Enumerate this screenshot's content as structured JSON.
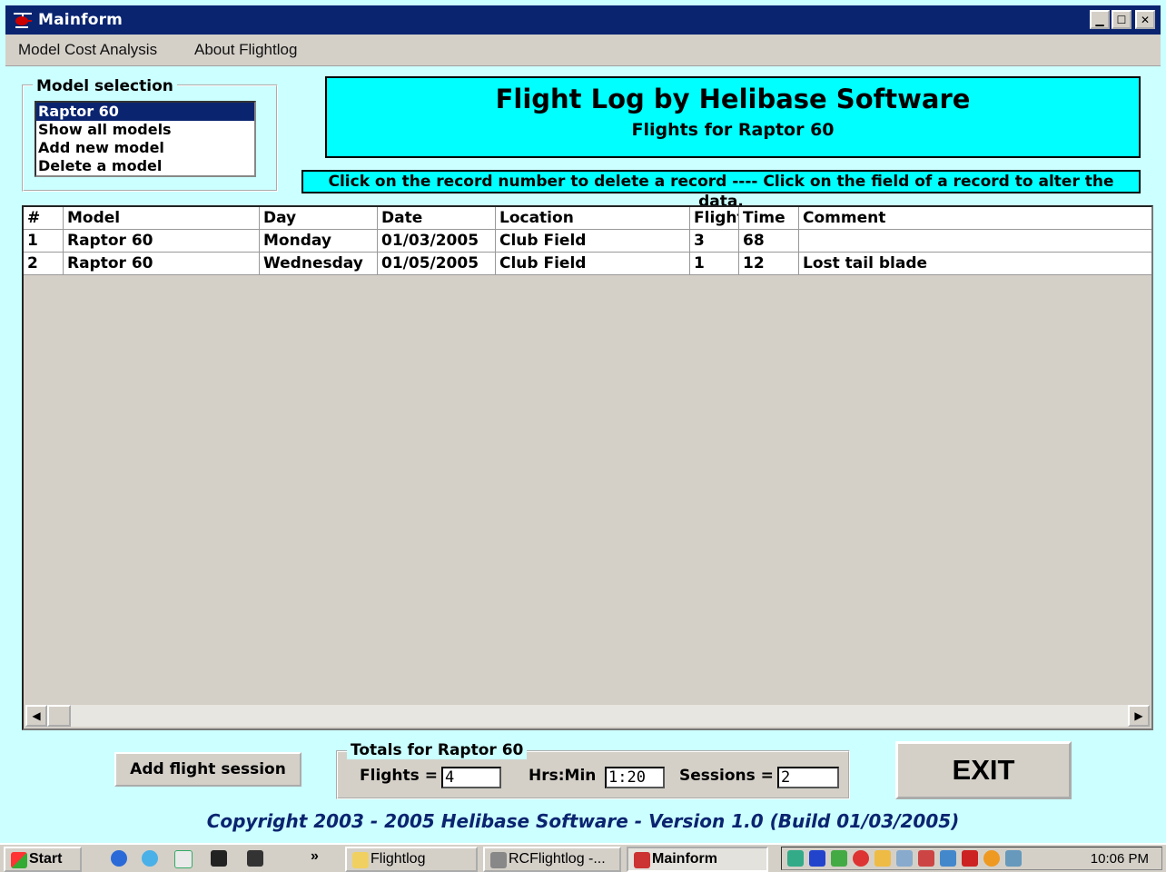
{
  "window": {
    "title": "Mainform"
  },
  "menu": {
    "items": [
      "Model Cost Analysis",
      "About Flightlog"
    ]
  },
  "model_selection": {
    "legend": "Model selection",
    "options": [
      "Raptor 60",
      "Show all models",
      "Add new model",
      "Delete a model"
    ],
    "selected": "Raptor 60"
  },
  "banner": {
    "title": "Flight Log by Helibase Software",
    "subtitle": "Flights for Raptor 60"
  },
  "instruction": "Click on the record number to delete a record ---- Click on the field of a record to alter the data.",
  "grid": {
    "columns": [
      "#",
      "Model",
      "Day",
      "Date",
      "Location",
      "Flight",
      "Time",
      "Comment"
    ],
    "rows": [
      [
        "1",
        "Raptor 60",
        "Monday",
        "01/03/2005",
        "Club Field",
        "3",
        "68",
        ""
      ],
      [
        "2",
        "Raptor 60",
        "Wednesday",
        "01/05/2005",
        "Club Field",
        "1",
        "12",
        "Lost tail blade"
      ]
    ]
  },
  "buttons": {
    "add_flight": "Add flight session",
    "exit": "EXIT"
  },
  "totals": {
    "legend": "Totals for Raptor 60",
    "flights_label": "Flights =",
    "flights_value": "4",
    "hrsmin_label": "Hrs:Min",
    "hrsmin_value": "1:20",
    "sessions_label": "Sessions =",
    "sessions_value": "2"
  },
  "copyright": "Copyright 2003 - 2005  Helibase Software  - Version 1.0 (Build 01/03/2005)",
  "taskbar": {
    "start": "Start",
    "chevron": "»",
    "tasks": [
      "Flightlog",
      "RCFlightlog -...",
      "Mainform"
    ],
    "active_task": "Mainform",
    "clock": "10:06 PM"
  },
  "colors": {
    "title_bar": "#0a2470",
    "form_bg": "#ccffff",
    "banner_bg": "#00ffff"
  }
}
